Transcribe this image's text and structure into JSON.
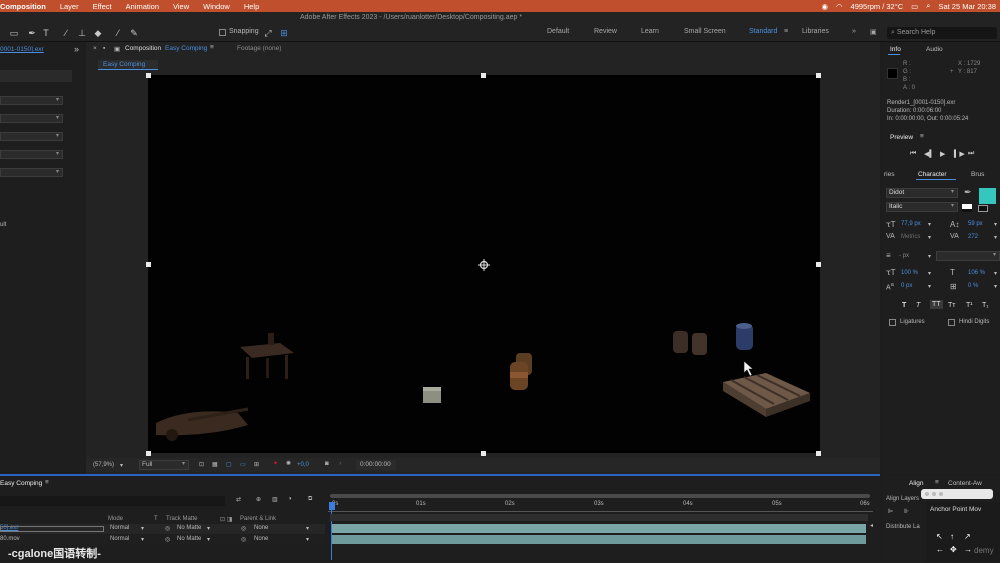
{
  "menubar": {
    "items": [
      "Composition",
      "Layer",
      "Effect",
      "Animation",
      "View",
      "Window",
      "Help"
    ],
    "status": "4995rpm / 32°C",
    "datetime": "Sat 25 Mar  20:38"
  },
  "window_title": "Adobe After Effects 2023 - /Users/ruanlotter/Desktop/Compositing.aep *",
  "toolbar": {
    "snapping_label": "Snapping"
  },
  "workspaces": {
    "items": [
      "Default",
      "Review",
      "Learn",
      "Small Screen",
      "Standard",
      "Libraries"
    ],
    "active": "Standard"
  },
  "search_help": "Search Help",
  "project_panel": {
    "tab_label": "0001-0150].exr",
    "left_text": "ult"
  },
  "comp_panel": {
    "tab_label": "Composition",
    "tab_comp_name": "Easy Comping",
    "footage_tab": "Footage (none)",
    "subtab": "Easy Comping",
    "zoom": "(57,9%)",
    "resolution": "Full",
    "exposure": "+0,0",
    "timecode": "0:00:00:00"
  },
  "info_panel": {
    "tabs": [
      "Info",
      "Audio"
    ],
    "r": "R :",
    "g": "G :",
    "b": "B :",
    "a": "A : 0",
    "x": "X : 1729",
    "y": "Y : 817",
    "file": "Render1_[0001-0150].exr",
    "duration": "Duration: 0:00:06:00",
    "in_out": "In: 0:00:00:00, Out: 0:00:05:24"
  },
  "preview_panel": {
    "title": "Preview"
  },
  "character_panel": {
    "tabs": [
      "ries",
      "Character",
      "Brus"
    ],
    "font": "Didot",
    "style": "Italic",
    "size": "77,9 px",
    "leading": "59 px",
    "kerning": "Metrics",
    "tracking": "272",
    "stroke": "- px",
    "vscale": "100 %",
    "hscale": "106 %",
    "baseline": "0 px",
    "tsume": "0 %",
    "ligatures": "Ligatures",
    "hindi_digits": "Hindi Digits",
    "fill_color": "#36c6c0"
  },
  "timeline": {
    "tab_label": "Easy Comping",
    "col_mode": "Mode",
    "col_t": "T",
    "col_track_matte": "Track Matte",
    "col_parent": "Parent & Link",
    "rows": [
      {
        "name": "50].exr",
        "mode": "Normal",
        "matte": "No Matte",
        "parent": "None"
      },
      {
        "name": "80.mov",
        "mode": "Normal",
        "matte": "No Matte",
        "parent": "None"
      }
    ],
    "ruler": [
      "0s",
      "01s",
      "02s",
      "03s",
      "04s",
      "05s",
      "06s"
    ]
  },
  "align_panel": {
    "tabs": [
      "Align",
      "Content-Aw"
    ],
    "align_layers": "Align Layers",
    "distribute": "Distribute La",
    "anchor_popup": "Anchor Point Mov"
  },
  "watermark": "-cgalone国语转制-",
  "udemy": "demy"
}
